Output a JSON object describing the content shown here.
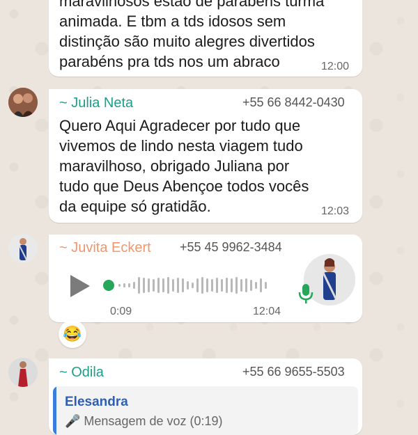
{
  "messages": [
    {
      "lines": [
        "maravilhosos estão de parabéns turma",
        "animada. E tbm a tds idosos sem",
        "distinção são muito alegres divertidos",
        "parabéns pra tds nos um abraco"
      ],
      "time": "12:00"
    },
    {
      "sender": "~ Julia Neta",
      "phone": "+55 66 8442-0430",
      "sender_color": "#1aa089",
      "lines": [
        "Quero Aqui Agradecer por tudo que",
        "vivemos de lindo nesta viagem tudo",
        "maravilhoso, obrigado Juliana por",
        "tudo que Deus Abençoe todos vocês",
        "da equipe só gratidão."
      ],
      "time": "12:03"
    },
    {
      "sender": "~ Juvita Eckert",
      "phone": "+55 45 9962-3484",
      "sender_color": "#f2966b",
      "audio": {
        "duration": "0:09",
        "time": "12:04",
        "progress": 0
      },
      "reaction": "😂"
    },
    {
      "sender": "~ Odila",
      "phone": "+55 66 9655-5503",
      "sender_color": "#1aa089",
      "quoted_name": "Elesandra",
      "quoted_preview": "🎤 Mensagem de voz (0:19)"
    }
  ],
  "colors": {
    "accent_green": "#25a65b",
    "quote_bar": "#3a7dde",
    "play_gray": "#7b7b7b"
  }
}
